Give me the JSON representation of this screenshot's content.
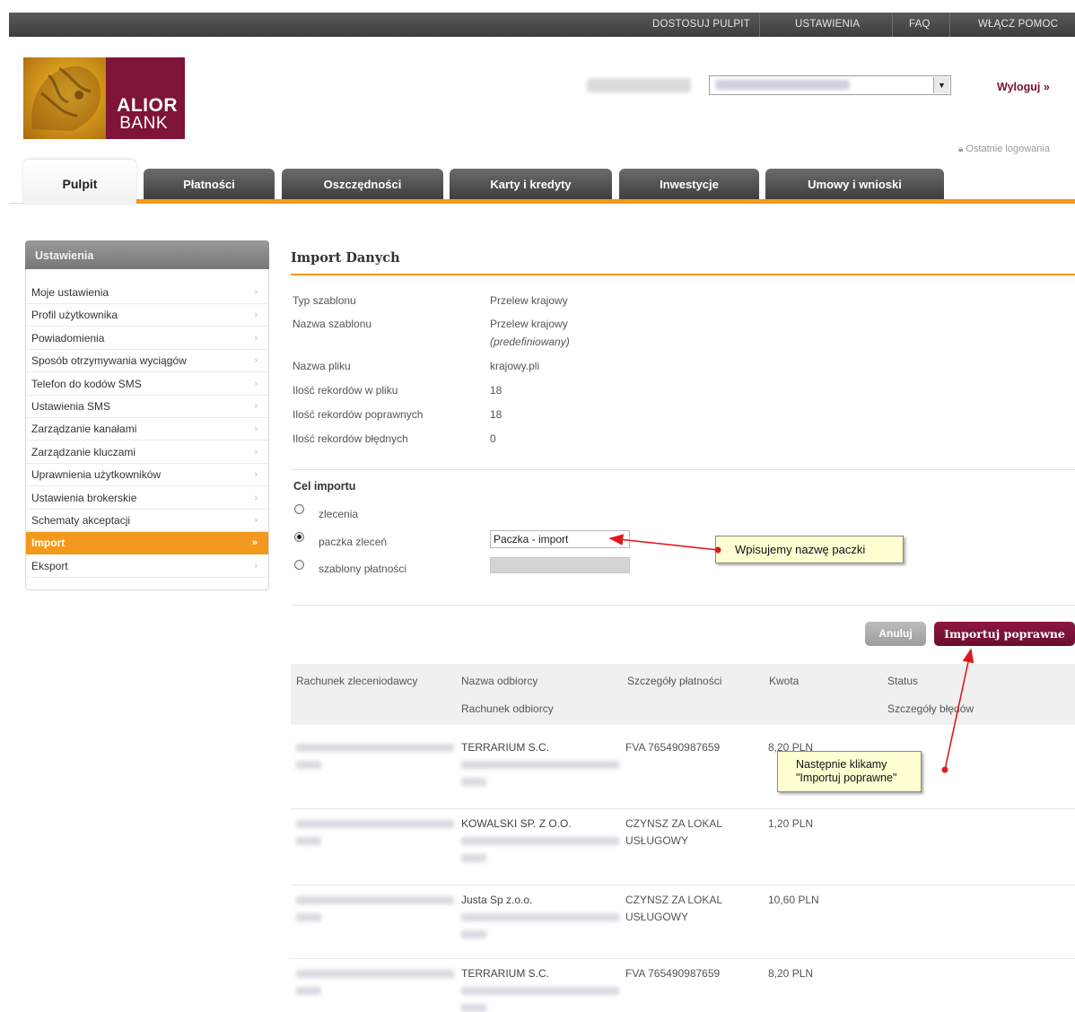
{
  "topbar": {
    "links": [
      "DOSTOSUJ PULPIT",
      "USTAWIENIA",
      "FAQ",
      "WŁĄCZ POMOC"
    ]
  },
  "logo": {
    "line1": "ALIOR",
    "line2": "BANK"
  },
  "header": {
    "logout_label": "Wyloguj »",
    "last_logins_label": "Ostatnie logowania"
  },
  "tabs": [
    {
      "label": "Pulpit",
      "active": true
    },
    {
      "label": "Płatności"
    },
    {
      "label": "Oszczędności"
    },
    {
      "label": "Karty i kredyty"
    },
    {
      "label": "Inwestycje"
    },
    {
      "label": "Umowy i wnioski"
    }
  ],
  "sidebar": {
    "title": "Ustawienia",
    "items": [
      "Moje ustawienia",
      "Profil użytkownika",
      "Powiadomienia",
      "Sposób otrzymywania wyciągów",
      "Telefon do kodów SMS",
      "Ustawienia SMS",
      "Zarządzanie kanałami",
      "Zarządzanie kluczami",
      "Uprawnienia użytkowników",
      "Ustawienia brokerskie",
      "Schematy akceptacji",
      "Import",
      "Eksport"
    ],
    "active_index": 11,
    "chevron": "›",
    "active_chevron": "»"
  },
  "main": {
    "title": "Import Danych",
    "details": [
      {
        "label": "Typ szablonu",
        "value": "Przelew krajowy"
      },
      {
        "label": "Nazwa szablonu",
        "value": "Przelew krajowy",
        "note": "(predefiniowany)"
      },
      {
        "label": "Nazwa pliku",
        "value": "krajowy.pli"
      },
      {
        "label": "Ilość rekordów w pliku",
        "value": "18"
      },
      {
        "label": "Ilość rekordów poprawnych",
        "value": "18"
      },
      {
        "label": "Ilość rekordów błędnych",
        "value": "0"
      }
    ],
    "target": {
      "title": "Cel importu",
      "options": [
        "zlecenia",
        "paczka zleceń",
        "szablony płatności"
      ],
      "selected_index": 1,
      "package_name": "Paczka - import"
    },
    "buttons": {
      "cancel": "Anuluj",
      "import": "Importuj poprawne"
    },
    "table": {
      "headers": {
        "col1": "Rachunek zleceniodawcy",
        "col2_line1": "Nazwa odbiorcy",
        "col2_line2": "Rachunek odbiorcy",
        "col3": "Szczegóły płatności",
        "col4": "Kwota",
        "col5_line1": "Status",
        "col5_line2": "Szczegóły błędów"
      },
      "rows": [
        {
          "recipient": "TERRARIUM S.C.",
          "details_line1": "FVA 765490987659",
          "details_line2": "",
          "amount": "8,20 PLN"
        },
        {
          "recipient": "KOWALSKI SP. Z O.O.",
          "details_line1": "CZYNSZ ZA LOKAL",
          "details_line2": "USŁUGOWY",
          "amount": "1,20 PLN"
        },
        {
          "recipient": "Justa Sp z.o.o.",
          "details_line1": "CZYNSZ ZA LOKAL",
          "details_line2": "USŁUGOWY",
          "amount": "10,60 PLN"
        },
        {
          "recipient": "TERRARIUM S.C.",
          "details_line1": "FVA 765490987659",
          "details_line2": "",
          "amount": "8,20 PLN"
        }
      ]
    }
  },
  "annotations": {
    "callout1": "Wpisujemy nazwę paczki",
    "callout2_line1": "Następnie klikamy",
    "callout2_line2": "\"Importuj poprawne\""
  },
  "colors": {
    "brand": "#7e1436",
    "accent": "#f39a1e",
    "arrow": "#e0191e"
  }
}
